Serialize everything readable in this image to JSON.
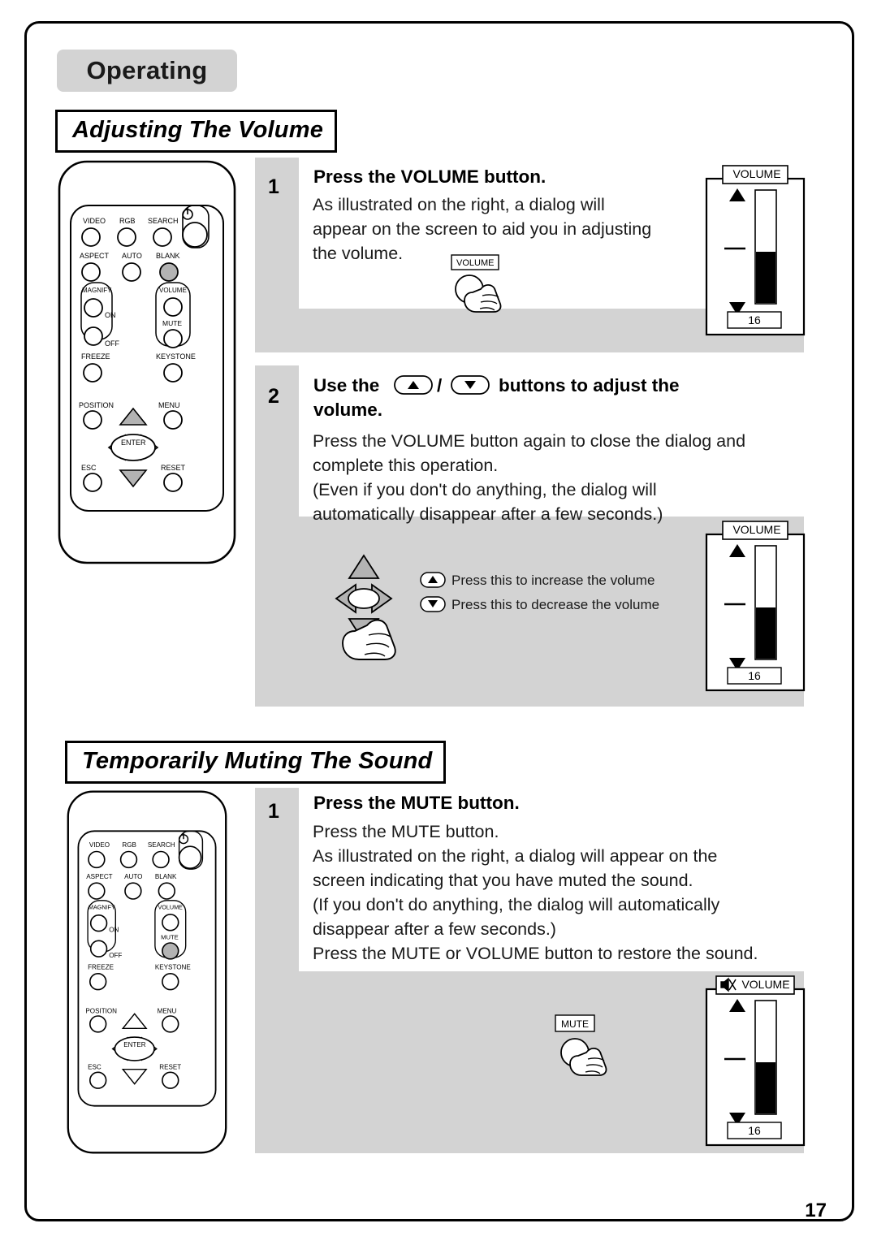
{
  "document": {
    "chapter_tab": "Operating",
    "page_number": "17"
  },
  "sections": [
    {
      "id": "volume",
      "title": "Adjusting The Volume",
      "steps": [
        {
          "number": "1",
          "heading": "Press the VOLUME button.",
          "body": "As illustrated on the right, a dialog will\nappear on the screen to aid you in adjusting\nthe volume.",
          "callout_button": "VOLUME"
        },
        {
          "number": "2",
          "heading_part1": "Use the",
          "heading_part2": "/",
          "heading_part3": "buttons to adjust the",
          "heading_part4": "volume.",
          "body": "Press the VOLUME button again to close the dialog and\ncomplete this operation.\n(Even if you don't do anything, the dialog will\nautomatically disappear after a few seconds.)",
          "note_up": "Press this to increase the volume",
          "note_down": "Press this to decrease the volume"
        }
      ]
    },
    {
      "id": "mute",
      "title": "Temporarily Muting The Sound",
      "steps": [
        {
          "number": "1",
          "heading": "Press the MUTE button.",
          "body": "Press the MUTE button.\nAs illustrated on the right, a dialog will appear on the\nscreen indicating that you have muted the sound.\n(If you don't do anything, the dialog will automatically\ndisappear after a few seconds.)\nPress the MUTE or VOLUME button to restore the sound.",
          "callout_button": "MUTE"
        }
      ]
    }
  ],
  "osd_dialogs": [
    {
      "name": "volume-osd-step1",
      "title": "VOLUME",
      "value": "16",
      "muted": false
    },
    {
      "name": "volume-osd-step2",
      "title": "VOLUME",
      "value": "16",
      "muted": false
    },
    {
      "name": "volume-osd-mute",
      "title": "VOLUME",
      "value": "16",
      "muted": true
    }
  ],
  "remote": {
    "rows": [
      {
        "labels": [
          "VIDEO",
          "RGB",
          "SEARCH",
          "power-icon"
        ]
      },
      {
        "labels": [
          "ASPECT",
          "AUTO",
          "BLANK"
        ]
      },
      {
        "labels": [
          "MAGNIFY",
          "VOLUME"
        ]
      },
      {
        "labels": [
          "ON",
          "MUTE"
        ]
      },
      {
        "labels": [
          "OFF"
        ]
      },
      {
        "labels": [
          "FREEZE",
          "KEYSTONE"
        ]
      },
      {
        "labels": [
          "POSITION",
          "MENU"
        ]
      },
      {
        "labels": [
          "ENTER"
        ]
      },
      {
        "labels": [
          "ESC",
          "RESET"
        ]
      }
    ],
    "labels": {
      "video": "VIDEO",
      "rgb": "RGB",
      "search": "SEARCH",
      "aspect": "ASPECT",
      "auto": "AUTO",
      "blank": "BLANK",
      "magnify": "MAGNIFY",
      "volume": "VOLUME",
      "on": "ON",
      "mute": "MUTE",
      "off": "OFF",
      "freeze": "FREEZE",
      "keystone": "KEYSTONE",
      "position": "POSITION",
      "menu": "MENU",
      "enter": "ENTER",
      "esc": "ESC",
      "reset": "RESET"
    }
  }
}
